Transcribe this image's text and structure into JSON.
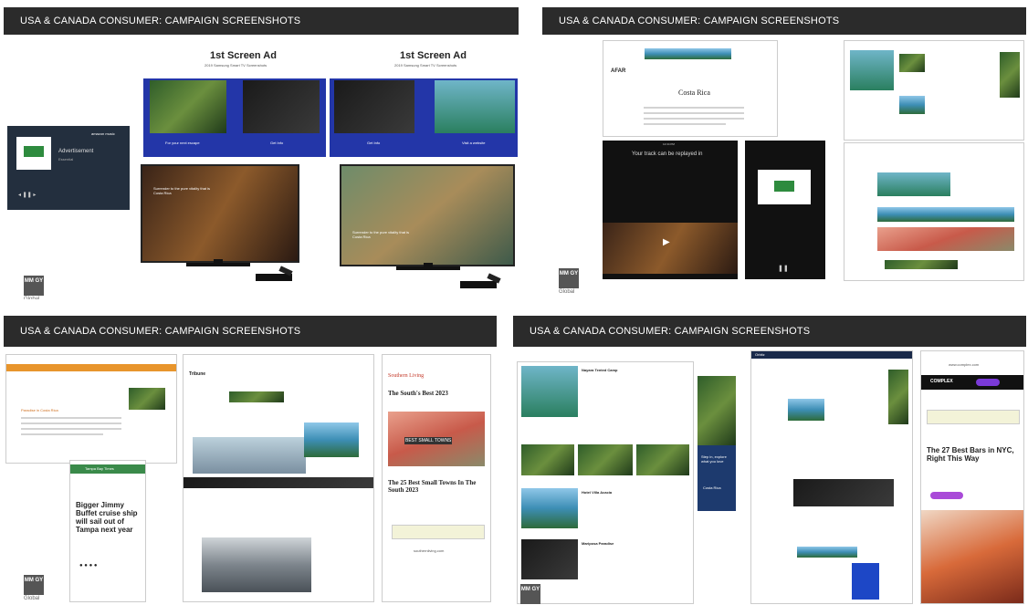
{
  "slides": {
    "header_title": "USA & CANADA CONSUMER: CAMPAIGN SCREENSHOTS",
    "logo": {
      "mark": "MM GY",
      "sub": "Global"
    },
    "s1": {
      "ad_title_left": "1st Screen Ad",
      "ad_sub_left": "2019 Samsung Smart TV Screenshots",
      "ad_title_right": "1st Screen Ad",
      "ad_sub_right": "2019 Samsung Smart TV Screenshots",
      "captions": [
        "For your next escape",
        "Get Info",
        "Get Info",
        "Visit a website"
      ],
      "amazon_label": "amazon music",
      "ad_label": "Advertisement",
      "ad_brand": "Essential",
      "tv_overlay_1": "Surrender to the pure vitality that is Costa Rica",
      "tv_overlay_2": "Surrender to the pure vitality that is Costa Rica"
    },
    "s2": {
      "site": "AFAR",
      "article_title": "Costa Rica",
      "video_text": "Your track can be replayed in",
      "status_time": "12:34 PM"
    },
    "s3": {
      "left_heading": "Paradise in Costa Rica",
      "phone_site": "Tampa Bay Times",
      "phone_headline": "Bigger Jimmy Buffet cruise ship will sail out of Tampa next year",
      "mid_logo": "Tribune",
      "sl_logo": "Southern Living",
      "sl_headline_1": "The South's Best 2023",
      "sl_town_sign": "BEST SMALL TOWNS",
      "sl_headline_2": "The 25 Best Small Towns In The South 2023",
      "sl_url": "southernliving.com"
    },
    "s4": {
      "listing_1": "Nayara Tented Camp",
      "listing_2": "Hotel Villa Acacia",
      "listing_3": "Mariposa Paradise",
      "ad_panel_text": "Step in, explore what you love",
      "ad_panel_brand": "Costa Rica",
      "site_logo": "Orbitz",
      "phone_brand": "COMPLEX",
      "phone_headline": "The 27 Best Bars in NYC, Right This Way",
      "phone_url": "www.complex.com"
    }
  }
}
